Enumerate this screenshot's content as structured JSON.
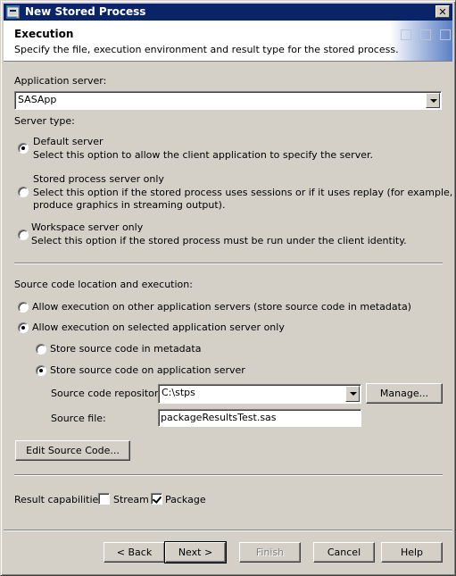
{
  "window": {
    "title": "New Stored Process",
    "icon": "stored-process-icon",
    "close_icon": "close-icon"
  },
  "header": {
    "title": "Execution",
    "subtitle": "Specify the file, execution environment and result type for the stored process."
  },
  "application_server": {
    "label": "Application server:",
    "value": "SASApp"
  },
  "server_type": {
    "label": "Server type:",
    "options": [
      {
        "title": "Default server",
        "description": "Select this option to allow the client application to specify the server.",
        "selected": true
      },
      {
        "title": "Stored process server only",
        "description": "Select this option if the stored process uses sessions or if it uses replay (for example, to",
        "description2": "produce graphics in streaming output).",
        "selected": false
      },
      {
        "title": "Workspace server only",
        "description": "Select this option if the stored process must be run under the client identity.",
        "selected": false
      }
    ]
  },
  "source_code": {
    "label": "Source code location and execution:",
    "execution_options": [
      {
        "label": "Allow execution on other application servers (store source code in metadata)",
        "selected": false
      },
      {
        "label": "Allow execution on selected application server only",
        "selected": true
      }
    ],
    "storage_options": [
      {
        "label": "Store source code in metadata",
        "selected": false
      },
      {
        "label": "Store source code on application server",
        "selected": true
      }
    ],
    "repository_label": "Source code repository:",
    "repository_value": "C:\\stps",
    "manage_label": "Manage...",
    "source_file_label": "Source file:",
    "source_file_value": "packageResultsTest.sas",
    "edit_label": "Edit Source Code..."
  },
  "result_capabilities": {
    "label": "Result capabilities:",
    "stream": {
      "label": "Stream",
      "checked": false
    },
    "package": {
      "label": "Package",
      "checked": true
    }
  },
  "footer": {
    "back": "< Back",
    "next": "Next >",
    "finish": "Finish",
    "cancel": "Cancel",
    "help": "Help"
  }
}
